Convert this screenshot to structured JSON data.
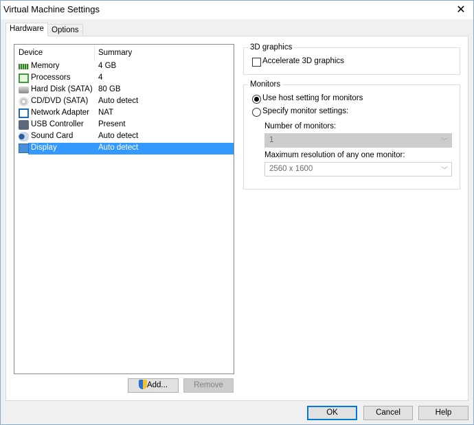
{
  "window": {
    "title": "Virtual Machine Settings",
    "close_icon": "close-icon"
  },
  "tabs": [
    {
      "label": "Hardware",
      "active": true
    },
    {
      "label": "Options",
      "active": false
    }
  ],
  "device_list": {
    "columns": [
      "Device",
      "Summary"
    ],
    "rows": [
      {
        "device": "Memory",
        "summary": "4 GB",
        "icon": "memory-icon"
      },
      {
        "device": "Processors",
        "summary": "4",
        "icon": "processor-icon"
      },
      {
        "device": "Hard Disk (SATA)",
        "summary": "80 GB",
        "icon": "hard-disk-icon"
      },
      {
        "device": "CD/DVD (SATA)",
        "summary": "Auto detect",
        "icon": "cd-dvd-icon"
      },
      {
        "device": "Network Adapter",
        "summary": "NAT",
        "icon": "network-adapter-icon"
      },
      {
        "device": "USB Controller",
        "summary": "Present",
        "icon": "usb-icon"
      },
      {
        "device": "Sound Card",
        "summary": "Auto detect",
        "icon": "sound-card-icon"
      },
      {
        "device": "Display",
        "summary": "Auto detect",
        "icon": "display-icon",
        "selected": true
      }
    ]
  },
  "buttons": {
    "add": "Add...",
    "remove": "Remove",
    "ok": "OK",
    "cancel": "Cancel",
    "help": "Help"
  },
  "graphics3d": {
    "label": "3D graphics",
    "accelerate_label": "Accelerate 3D graphics",
    "accelerate_checked": false
  },
  "monitors": {
    "label": "Monitors",
    "use_host_label": "Use host setting for monitors",
    "specify_label": "Specify monitor settings:",
    "selected": "use_host",
    "number_label": "Number of monitors:",
    "number_value": "1",
    "resolution_label": "Maximum resolution of any one monitor:",
    "resolution_value": "2560 x 1600"
  },
  "colors": {
    "selection": "#3399ff",
    "default_button_border": "#0078d7"
  }
}
